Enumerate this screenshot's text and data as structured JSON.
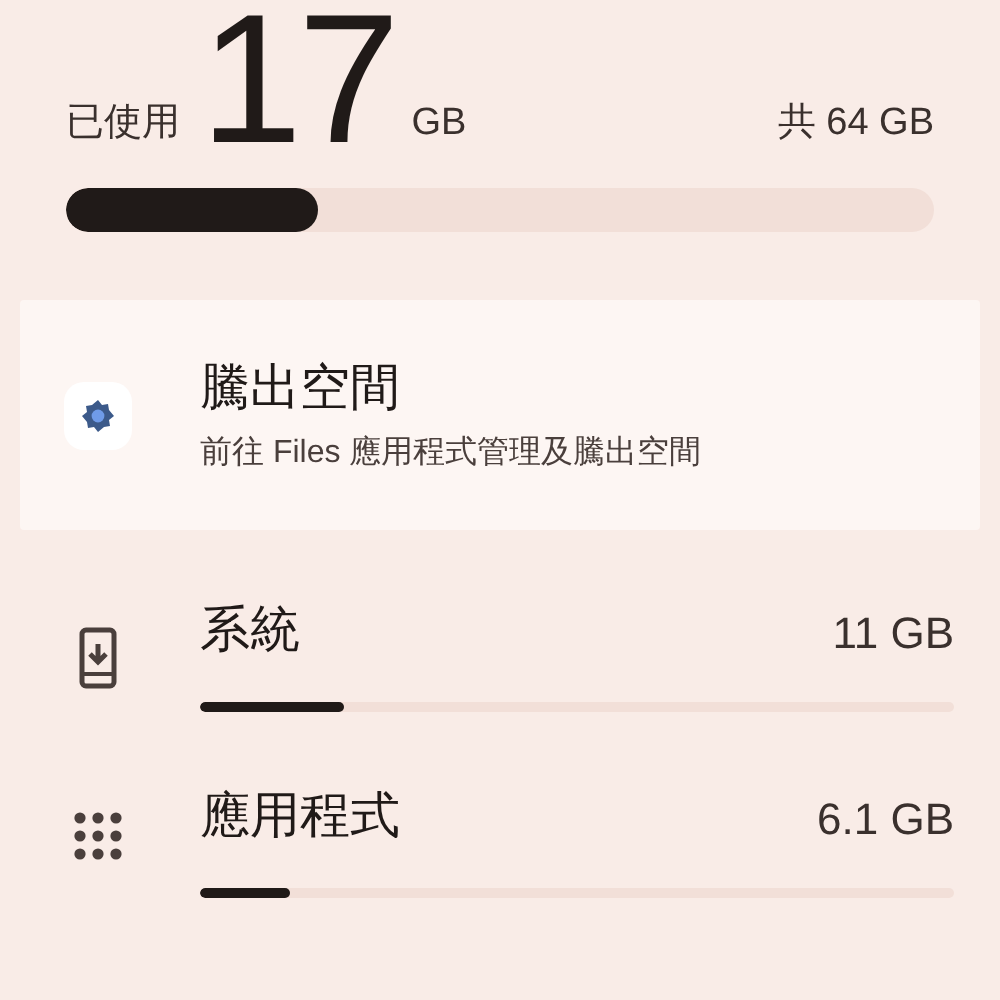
{
  "usage": {
    "label": "已使用",
    "amount": "17",
    "unit": "GB",
    "total": "共 64 GB",
    "level": 0.29
  },
  "free_up": {
    "title": "騰出空間",
    "subtitle": "前往 Files 應用程式管理及騰出空間"
  },
  "categories": [
    {
      "kind": "system",
      "name": "系統",
      "size": "11 GB",
      "level": 0.19
    },
    {
      "kind": "apps",
      "name": "應用程式",
      "size": "6.1 GB",
      "level": 0.12
    }
  ]
}
